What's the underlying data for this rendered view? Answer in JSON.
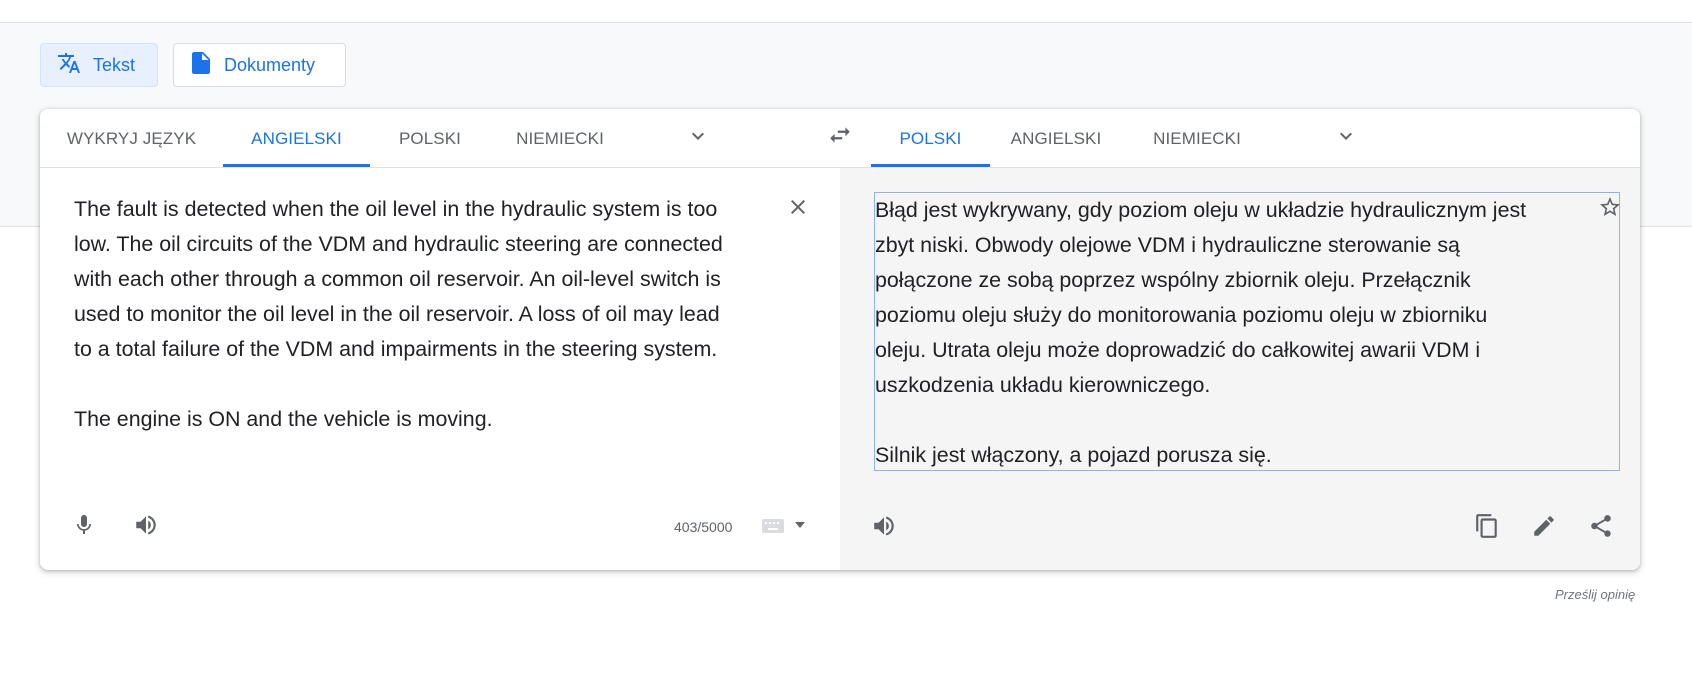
{
  "modes": {
    "text_label": "Tekst",
    "documents_label": "Dokumenty"
  },
  "source_tabs": [
    "WYKRYJ JĘZYK",
    "ANGIELSKI",
    "POLSKI",
    "NIEMIECKI"
  ],
  "source_active": "ANGIELSKI",
  "target_tabs": [
    "POLSKI",
    "ANGIELSKI",
    "NIEMIECKI"
  ],
  "target_active": "POLSKI",
  "source_text": "The fault is detected when the oil level in the hydraulic system is too\nlow. The oil circuits of the VDM and hydraulic steering are connected\nwith each other through a common oil reservoir. An oil-level switch is\nused to monitor the oil level in the oil reservoir. A loss of oil may lead\nto a total failure of the VDM and impairments in the steering system.\n\nThe engine is ON and the vehicle is moving.",
  "target_text": "Błąd jest wykrywany, gdy poziom oleju w układzie hydraulicznym jest\nzbyt niski. Obwody olejowe VDM i hydrauliczne sterowanie są\npołączone ze sobą poprzez wspólny zbiornik oleju. Przełącznik\npoziomu oleju służy do monitorowania poziomu oleju w zbiorniku\noleju. Utrata oleju może doprowadzić do całkowitej awarii VDM i\nuszkodzenia układu kierowniczego.\n\nSilnik jest włączony, a pojazd porusza się.",
  "char_counter": "403/5000",
  "feedback_link": "Prześlij opinię",
  "colors": {
    "accent": "#1a73e8",
    "active_mode_bg": "#e8f0fe",
    "target_bg": "#f5f5f5",
    "icon": "#5f6368"
  },
  "icons": [
    "translate-icon",
    "document-icon",
    "chevron-down-icon",
    "swap-icon",
    "close-icon",
    "star-icon",
    "microphone-icon",
    "speaker-icon",
    "keyboard-icon",
    "copy-icon",
    "edit-icon",
    "share-icon"
  ]
}
